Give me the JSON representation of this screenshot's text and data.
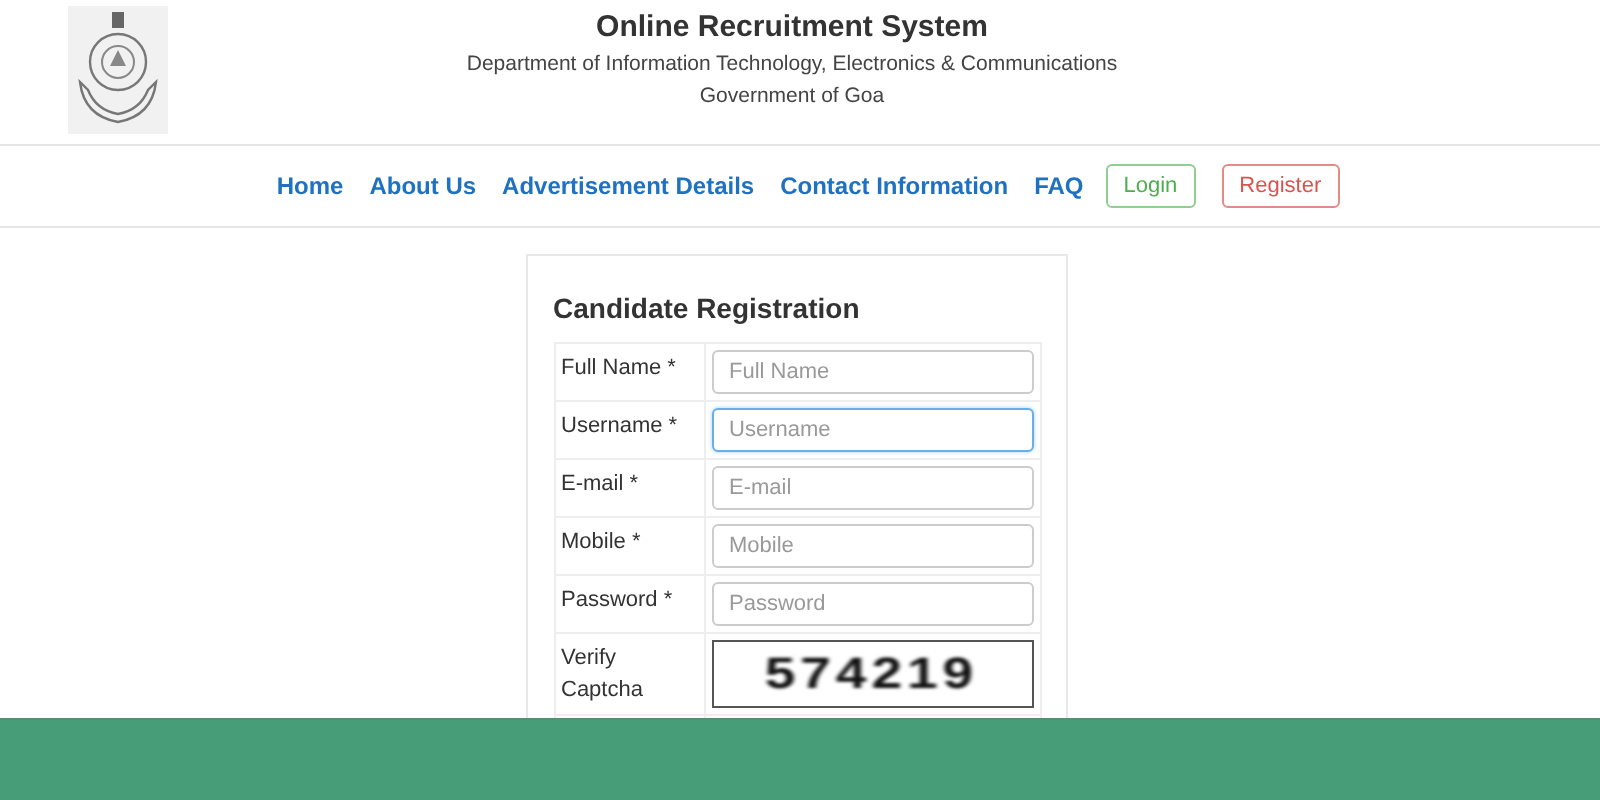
{
  "header": {
    "title": "Online Recruitment System",
    "department": "Department of Information Technology, Electronics & Communications",
    "government": "Government of Goa"
  },
  "nav": {
    "links": [
      "Home",
      "About Us",
      "Advertisement Details",
      "Contact Information",
      "FAQ"
    ],
    "buttons": [
      {
        "label": "Login",
        "kind": "login"
      },
      {
        "label": "Register",
        "kind": "register"
      }
    ]
  },
  "form": {
    "title": "Candidate Registration",
    "fields": [
      {
        "label": "Full Name *",
        "placeholder": "Full Name",
        "focused": false
      },
      {
        "label": "Username *",
        "placeholder": "Username",
        "focused": true
      },
      {
        "label": "E-mail *",
        "placeholder": "E-mail",
        "focused": false
      },
      {
        "label": "Mobile *",
        "placeholder": "Mobile",
        "focused": false
      },
      {
        "label": "Password *",
        "placeholder": "Password",
        "focused": false
      }
    ],
    "captcha": {
      "label": "Verify Captcha",
      "code": "574219"
    }
  }
}
